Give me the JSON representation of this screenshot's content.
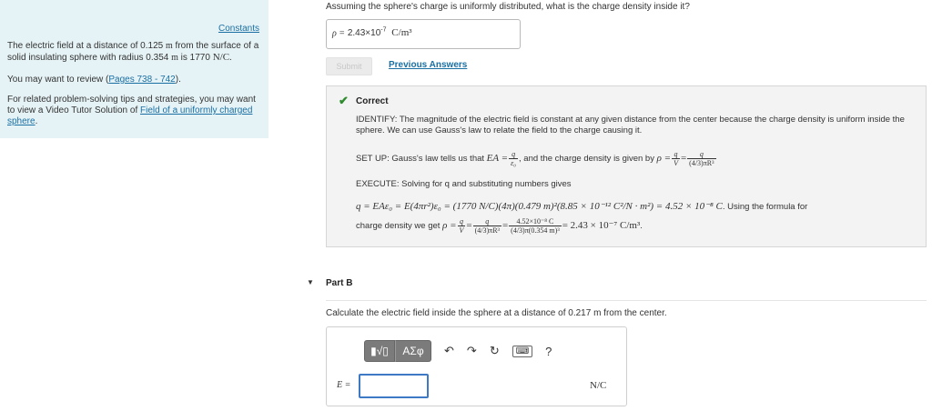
{
  "left_panel": {
    "constants_link": "Constants",
    "p1_a": "The electric field at a distance of 0.125 ",
    "p1_unit_m": "m",
    "p1_b": " from the surface of a solid insulating sphere with radius 0.354 ",
    "p1_unit_m2": "m",
    "p1_c": " is 1770 ",
    "p1_unit": "N/C",
    "p1_end": ".",
    "p2_a": "You may want to review (",
    "p2_link": "Pages 738 - 742",
    "p2_b": ").",
    "p3_a": "For related problem-solving tips and strategies, you may want to view a Video Tutor Solution of ",
    "p3_link": "Field of a uniformly charged sphere",
    "p3_b": "."
  },
  "part_a": {
    "question": "Assuming the sphere's charge is uniformly distributed, what is the charge density inside it?",
    "answer_symbol": "ρ =",
    "answer_value": "2.43×10",
    "answer_exp": "-7",
    "answer_unit": "C/m³",
    "submit_label": "Submit",
    "previous_answers_label": "Previous Answers"
  },
  "feedback": {
    "title": "Correct",
    "identify": "IDENTIFY: The magnitude of the electric field is constant at any given distance from the center because the charge density is uniform inside the sphere. We can use Gauss's law to relate the field to the charge causing it.",
    "setup_a": "SET UP: Gauss's law tells us that ",
    "setup_math": "EA =",
    "setup_b": ", and the charge density is given by ",
    "setup_rho": "ρ =",
    "execute": "EXECUTE: Solving for q and substituting numbers gives",
    "eq1": "q = EAε₀ = E(4πr²)ε₀ = (1770 N/C)(4π)(0.479 m)²(8.85 × 10⁻¹² C²/N · m²) = 4.52 × 10⁻⁸ C",
    "eq1_tail": ". Using the formula for",
    "eq2_a": "charge density we get ",
    "eq2_math": "ρ =",
    "eq2_result": "= 2.43 × 10⁻⁷ C/m³",
    "eq2_end": "."
  },
  "fractions": {
    "q": "q",
    "eps0": "ε₀",
    "V": "V",
    "vol": "(4/3)πR³",
    "num_val": "4.52×10⁻⁸ C",
    "den_val": "(4/3)π(0.354 m)³"
  },
  "part_b": {
    "label": "Part B",
    "question": "Calculate the electric field inside the sphere at a distance of 0.217 m from the center.",
    "e_label": "E =",
    "unit": "N/C",
    "toolbar_btn1": "▮√▯",
    "toolbar_btn2": "ΑΣφ",
    "undo_icon": "↶",
    "redo_icon": "↷",
    "reset_icon": "↻",
    "keyboard_icon": "⌨",
    "help_icon": "?"
  },
  "colors": {
    "panel_bg": "#e6f3f6",
    "link": "#1a6fa3",
    "check": "#2e8b2e",
    "input_border": "#3d79c4"
  }
}
